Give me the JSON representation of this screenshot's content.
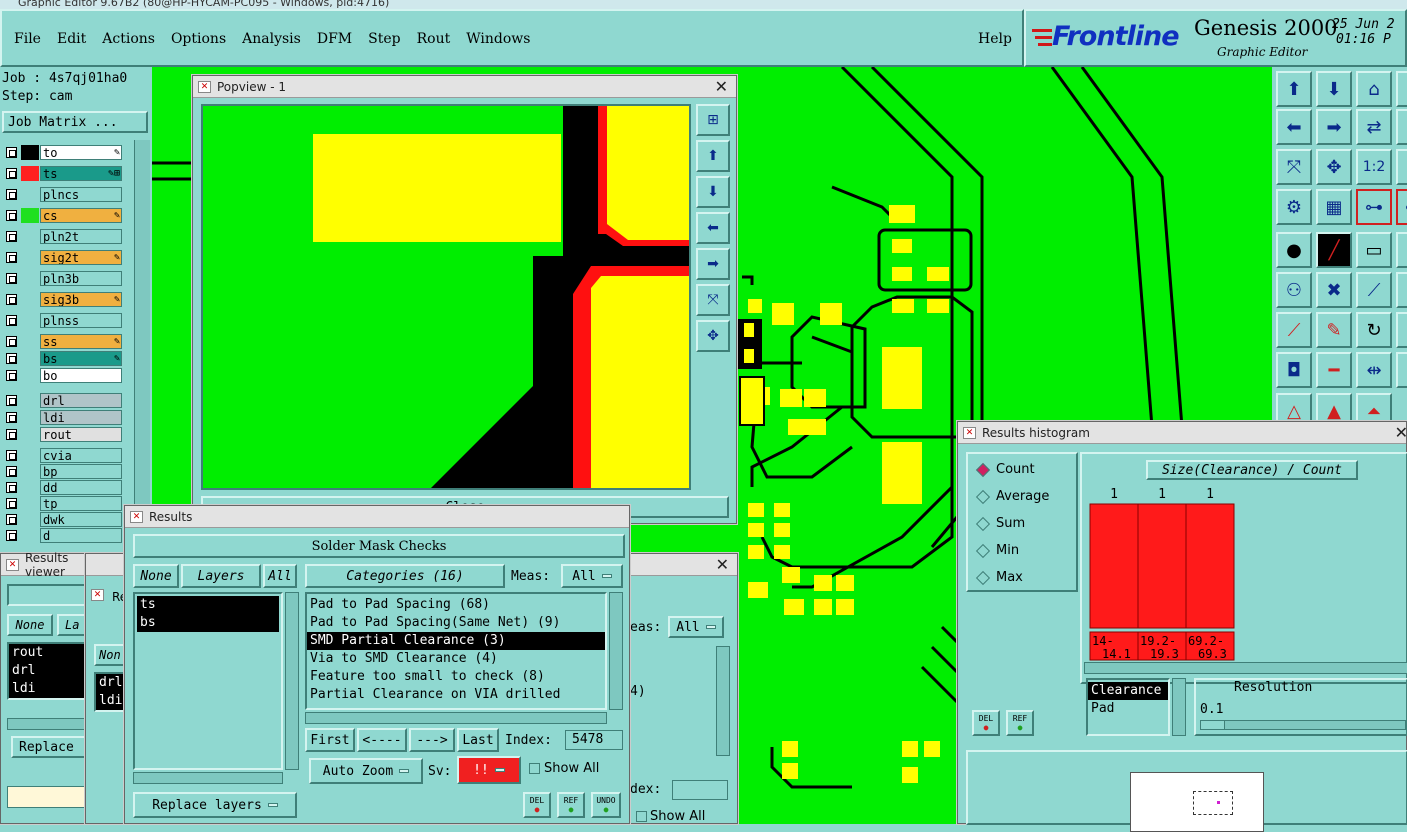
{
  "window_title": "Graphic Editor 9.67B2 (80@HP-HYCAM-PC095 - Windows, pid:4716)",
  "menu": [
    {
      "label": "File"
    },
    {
      "label": "Edit"
    },
    {
      "label": "Actions"
    },
    {
      "label": "Options"
    },
    {
      "label": "Analysis"
    },
    {
      "label": "DFM"
    },
    {
      "label": "Step"
    },
    {
      "label": "Rout"
    },
    {
      "label": "Windows"
    }
  ],
  "help_label": "Help",
  "brand": {
    "logo": "Frontline",
    "product": "Genesis 2000",
    "subtitle": "Graphic Editor",
    "date": "25 Jun 2",
    "time": "01:16 P"
  },
  "job": {
    "job_label": "Job : 4s7qj01ha0",
    "step_label": "Step: cam",
    "matrix_button": "Job Matrix ..."
  },
  "layers": [
    {
      "name": "to",
      "color": "#000000",
      "bg": "#ffffff",
      "icon": "✎",
      "group": 0
    },
    {
      "name": "ts",
      "color": "#ff2020",
      "bg": "#1a9a8a",
      "icon": "✎⊞",
      "group": 0
    },
    {
      "name": "plncs",
      "color": "",
      "bg": "#8fd8d0",
      "icon": "",
      "group": 0
    },
    {
      "name": "cs",
      "color": "#20e020",
      "bg": "#f0b040",
      "icon": "✎",
      "group": 0
    },
    {
      "name": "pln2t",
      "color": "",
      "bg": "#8fd8d0",
      "icon": "",
      "group": 0
    },
    {
      "name": "sig2t",
      "color": "",
      "bg": "#f0b040",
      "icon": "✎",
      "group": 0
    },
    {
      "name": "pln3b",
      "color": "",
      "bg": "#8fd8d0",
      "icon": "",
      "group": 0
    },
    {
      "name": "sig3b",
      "color": "",
      "bg": "#f0b040",
      "icon": "✎",
      "group": 0
    },
    {
      "name": "plnss",
      "color": "",
      "bg": "#8fd8d0",
      "icon": "",
      "group": 0
    },
    {
      "name": "ss",
      "color": "",
      "bg": "#f0b040",
      "icon": "✎",
      "group": 1
    },
    {
      "name": "bs",
      "color": "",
      "bg": "#1a9a8a",
      "icon": "✎",
      "group": 1
    },
    {
      "name": "bo",
      "color": "",
      "bg": "#ffffff",
      "icon": "",
      "group": 1
    },
    {
      "name": "drl",
      "color": "",
      "bg": "#b0c4c8",
      "icon": "",
      "group": 2
    },
    {
      "name": "ldi",
      "color": "",
      "bg": "#b0c4c8",
      "icon": "",
      "group": 2
    },
    {
      "name": "rout",
      "color": "",
      "bg": "#e0e0e0",
      "icon": "",
      "group": 2
    },
    {
      "name": "cvia",
      "color": "",
      "bg": "#8fd8d0",
      "icon": "",
      "group": 3
    },
    {
      "name": "bp",
      "color": "",
      "bg": "#8fd8d0",
      "icon": "",
      "group": 3
    },
    {
      "name": "dd",
      "color": "",
      "bg": "#8fd8d0",
      "icon": "",
      "group": 3
    },
    {
      "name": "tp",
      "color": "",
      "bg": "#8fd8d0",
      "icon": "",
      "group": 3
    },
    {
      "name": "dwk",
      "color": "",
      "bg": "#8fd8d0",
      "icon": "",
      "group": 3
    },
    {
      "name": "d",
      "color": "",
      "bg": "#8fd8d0",
      "icon": "",
      "group": 3
    }
  ],
  "popview": {
    "title": "Popview - 1",
    "close_label": "Close"
  },
  "results_viewer": {
    "title": "Results viewer",
    "none_label": "None",
    "layers_tab": "La",
    "layers": [
      "rout",
      "drl",
      "ldi"
    ],
    "replace_label": "Replace"
  },
  "results_viewer2": {
    "title": "Re",
    "none_label": "Non",
    "layers": [
      "drl",
      "ldi"
    ],
    "meas_fragment": "eas:",
    "meas_value": "All",
    "cat_fragment": "4)",
    "index_fragment": "dex:",
    "show_all": "Show All"
  },
  "results_main": {
    "title": "Results",
    "header": "Solder Mask Checks",
    "none_label": "None",
    "layers_label": "Layers",
    "all_label": "All",
    "selected_layers": [
      "ts",
      "bs"
    ],
    "categories_label": "Categories (16)",
    "meas_label": "Meas:",
    "meas_value": "All",
    "categories": [
      "Pad to Pad Spacing (68)",
      "Pad to Pad Spacing(Same Net) (9)",
      "SMD Partial Clearance (3)",
      "Via to SMD Clearance (4)",
      "Feature too small to check (8)",
      "Partial Clearance on VIA drilled"
    ],
    "selected_category": 2,
    "first_label": "First",
    "prev_label": "<----",
    "next_label": "--->",
    "last_label": "Last",
    "index_label": "Index:",
    "index_value": "5478",
    "zoom_label": "Auto Zoom",
    "sv_label": "Sv:",
    "sv_value": "!!",
    "show_all_label": "Show All",
    "replace_label": "Replace layers",
    "del_label": "DEL",
    "ref_label": "REF",
    "undo_label": "UNDO"
  },
  "histogram": {
    "title": "Results histogram",
    "options": [
      "Count",
      "Average",
      "Sum",
      "Min",
      "Max"
    ],
    "selected_option": 0,
    "chart_title": "Size(Clearance) / Count",
    "bars": [
      {
        "count": "1",
        "range_top": "14-",
        "range_bottom": "14.1"
      },
      {
        "count": "1",
        "range_top": "19.2-",
        "range_bottom": "19.3"
      },
      {
        "count": "1",
        "range_top": "69.2-",
        "range_bottom": "69.3"
      }
    ],
    "measures": [
      "Clearance",
      "Pad"
    ],
    "selected_measure": 0,
    "resolution_label": "Resolution",
    "resolution_value": "0.1",
    "del_label": "DEL",
    "ref_label": "REF"
  },
  "colors": {
    "board": "#00ee00",
    "pad": "#ffff00",
    "copper": "#000000",
    "highlight": "#ff1010",
    "panel": "#8fd8d0"
  }
}
